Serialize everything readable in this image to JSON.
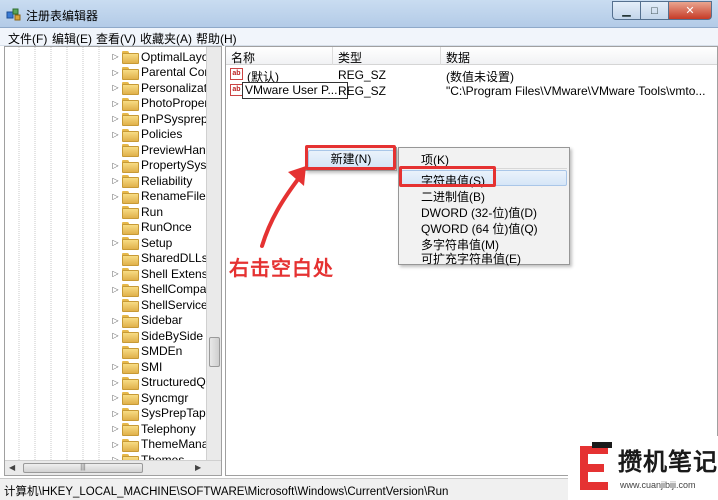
{
  "window": {
    "title": "注册表编辑器"
  },
  "menu": [
    "文件(F)",
    "编辑(E)",
    "查看(V)",
    "收藏夹(A)",
    "帮助(H)"
  ],
  "tree": [
    {
      "label": "OptimalLayo",
      "expandable": true
    },
    {
      "label": "Parental Con",
      "expandable": true
    },
    {
      "label": "Personalizati",
      "expandable": true
    },
    {
      "label": "PhotoProper",
      "expandable": true
    },
    {
      "label": "PnPSysprep",
      "expandable": true
    },
    {
      "label": "Policies",
      "expandable": true
    },
    {
      "label": "PreviewHand",
      "expandable": false
    },
    {
      "label": "PropertySyst",
      "expandable": true
    },
    {
      "label": "Reliability",
      "expandable": true
    },
    {
      "label": "RenameFiles",
      "expandable": true
    },
    {
      "label": "Run",
      "expandable": false
    },
    {
      "label": "RunOnce",
      "expandable": false
    },
    {
      "label": "Setup",
      "expandable": true
    },
    {
      "label": "SharedDLLs",
      "expandable": false
    },
    {
      "label": "Shell Extensio",
      "expandable": true
    },
    {
      "label": "ShellCompat",
      "expandable": true
    },
    {
      "label": "ShellServiceC",
      "expandable": false
    },
    {
      "label": "Sidebar",
      "expandable": true
    },
    {
      "label": "SideBySide",
      "expandable": true
    },
    {
      "label": "SMDEn",
      "expandable": false
    },
    {
      "label": "SMI",
      "expandable": true
    },
    {
      "label": "StructuredQu",
      "expandable": true
    },
    {
      "label": "Syncmgr",
      "expandable": true
    },
    {
      "label": "SysPrepTapi",
      "expandable": true
    },
    {
      "label": "Telephony",
      "expandable": true
    },
    {
      "label": "ThemeManag",
      "expandable": true
    },
    {
      "label": "Themes",
      "expandable": true
    }
  ],
  "list": {
    "headers": {
      "name": "名称",
      "type": "类型",
      "data": "数据"
    },
    "rows": [
      {
        "name": "(默认)",
        "type": "REG_SZ",
        "data": "(数值未设置)"
      },
      {
        "name": "VMware User P...",
        "type": "REG_SZ",
        "data": "\"C:\\Program Files\\VMware\\VMware Tools\\vmto..."
      }
    ]
  },
  "context_menu": {
    "new_label": "新建(N)",
    "submenu": [
      "项(K)",
      "字符串值(S)",
      "二进制值(B)",
      "DWORD (32-位)值(D)",
      "QWORD (64 位)值(Q)",
      "多字符串值(M)",
      "可扩充字符串值(E)"
    ]
  },
  "annotation": {
    "text": "右击空白处",
    "color": "#e53232"
  },
  "status": {
    "path": "计算机\\HKEY_LOCAL_MACHINE\\SOFTWARE\\Microsoft\\Windows\\CurrentVersion\\Run"
  },
  "watermark": {
    "title": "攒机笔记",
    "url": "www.cuanjibiji.com"
  }
}
